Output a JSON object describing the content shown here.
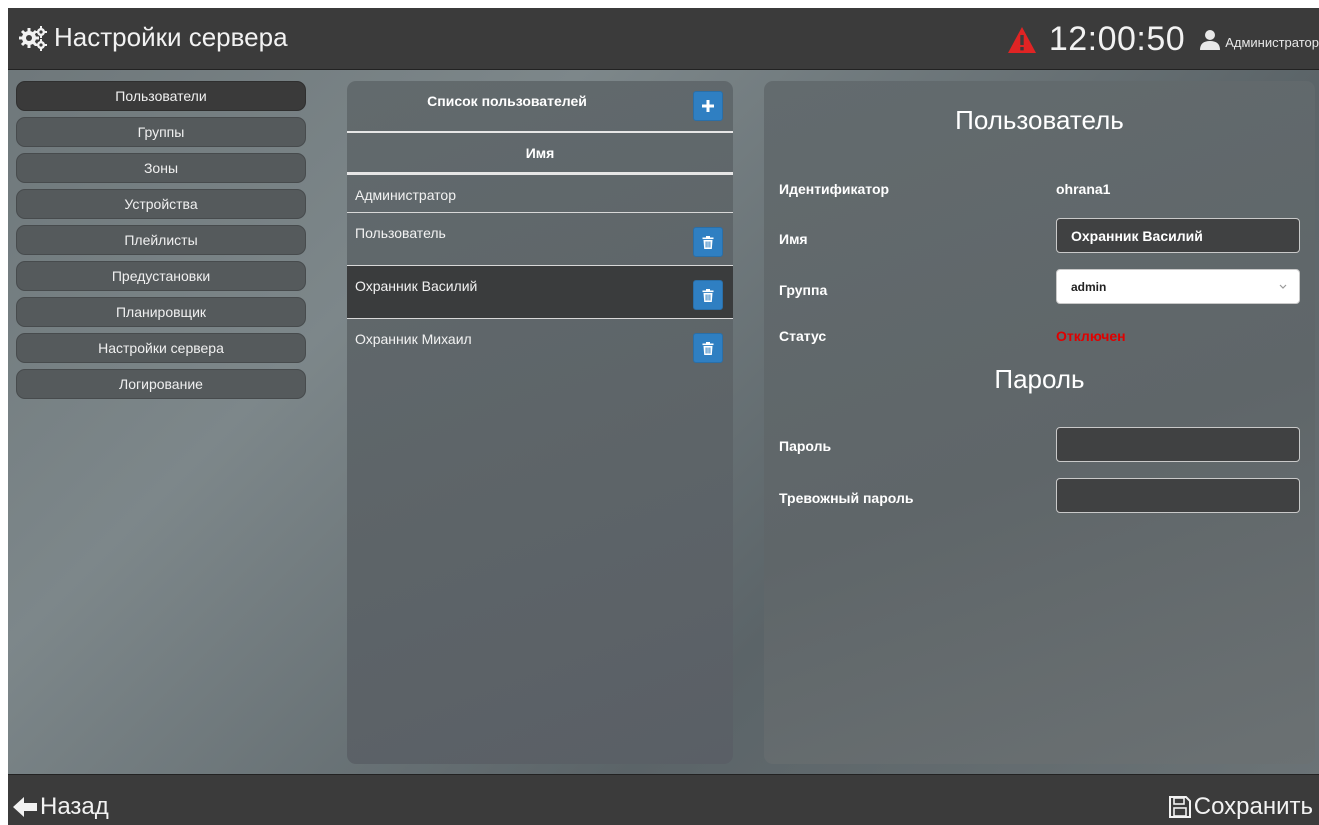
{
  "header": {
    "title": "Настройки сервера",
    "clock": "12:00:50",
    "user": "Администратор",
    "icons": {
      "settings": "gears-icon",
      "alarm": "warning-triangle-icon",
      "user": "user-icon"
    },
    "alarm_color": "#e02424"
  },
  "sidebar": {
    "items": [
      {
        "label": "Пользователи",
        "active": true
      },
      {
        "label": "Группы"
      },
      {
        "label": "Зоны"
      },
      {
        "label": "Устройства"
      },
      {
        "label": "Плейлисты"
      },
      {
        "label": "Предустановки"
      },
      {
        "label": "Планировщик"
      },
      {
        "label": "Настройки сервера"
      },
      {
        "label": "Логирование"
      }
    ]
  },
  "user_list": {
    "title": "Список пользователей",
    "add_icon": "plus-icon",
    "column": "Имя",
    "rows": [
      {
        "name": "Администратор",
        "deletable": false
      },
      {
        "name": "Пользователь",
        "deletable": true
      },
      {
        "name": "Охранник Василий",
        "deletable": true,
        "selected": true
      },
      {
        "name": "Охранник Михаил",
        "deletable": true
      }
    ],
    "delete_icon": "trash-icon",
    "button_color": "#2f7fc2"
  },
  "user_detail": {
    "heading": "Пользователь",
    "id_label": "Идентификатор",
    "id_value": "ohrana1",
    "name_label": "Имя",
    "name_value": "Охранник Василий",
    "group_label": "Группа",
    "group_value": "admin",
    "status_label": "Статус",
    "status_value": "Отключен",
    "status_color": "#e00000",
    "password_heading": "Пароль",
    "password_label": "Пароль",
    "password_value": "",
    "alarm_password_label": "Тревожный пароль",
    "alarm_password_value": ""
  },
  "footer": {
    "back_label": "Назад",
    "save_label": "Сохранить",
    "back_icon": "arrow-left-icon",
    "save_icon": "floppy-disk-icon"
  }
}
